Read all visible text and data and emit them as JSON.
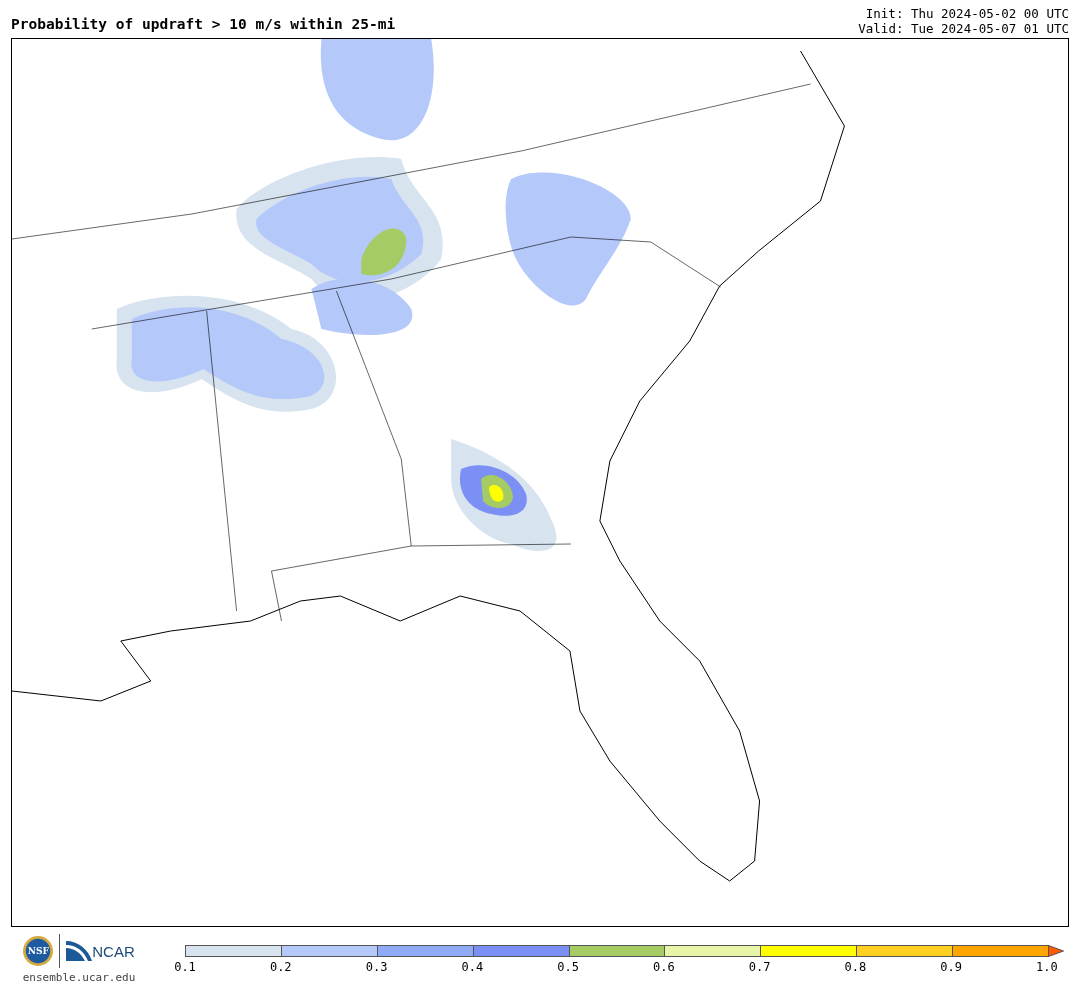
{
  "header": {
    "title": "Probability of updraft > 10 m/s within 25-mi",
    "init": "Init: Thu 2024-05-02 00 UTC",
    "valid": "Valid: Tue 2024-05-07 01 UTC"
  },
  "footer": {
    "nsf_logo": "NSF",
    "ncar_logo": "NCAR",
    "site": "ensemble.ucar.edu"
  },
  "colorbar": {
    "bins": [
      {
        "color": "#d7e3ee"
      },
      {
        "color": "#b4c8fa"
      },
      {
        "color": "#8fabf8"
      },
      {
        "color": "#7b8ff5"
      },
      {
        "color": "#a5cc64"
      },
      {
        "color": "#e8f5a8"
      },
      {
        "color": "#ffff00"
      },
      {
        "color": "#ffd020"
      },
      {
        "color": "#ffa500"
      },
      {
        "kind": "extend",
        "color": "#ff5a00"
      }
    ],
    "ticks": [
      "0.1",
      "0.2",
      "0.3",
      "0.4",
      "0.5",
      "0.6",
      "0.7",
      "0.8",
      "0.9",
      "1.0"
    ]
  }
}
